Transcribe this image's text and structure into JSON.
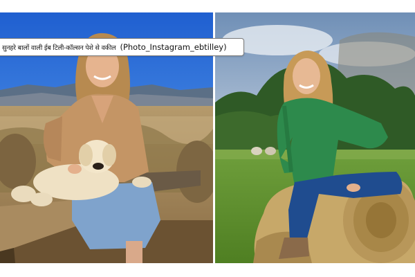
{
  "caption": {
    "hindi_text": "सुनहरे बालों वाली ईब टिली-कॉल्सन पेशे से वकील",
    "source_text": "(Photo_Instagram_ebtilley)"
  },
  "images": [
    {
      "name": "left-photo"
    },
    {
      "name": "right-photo"
    }
  ]
}
